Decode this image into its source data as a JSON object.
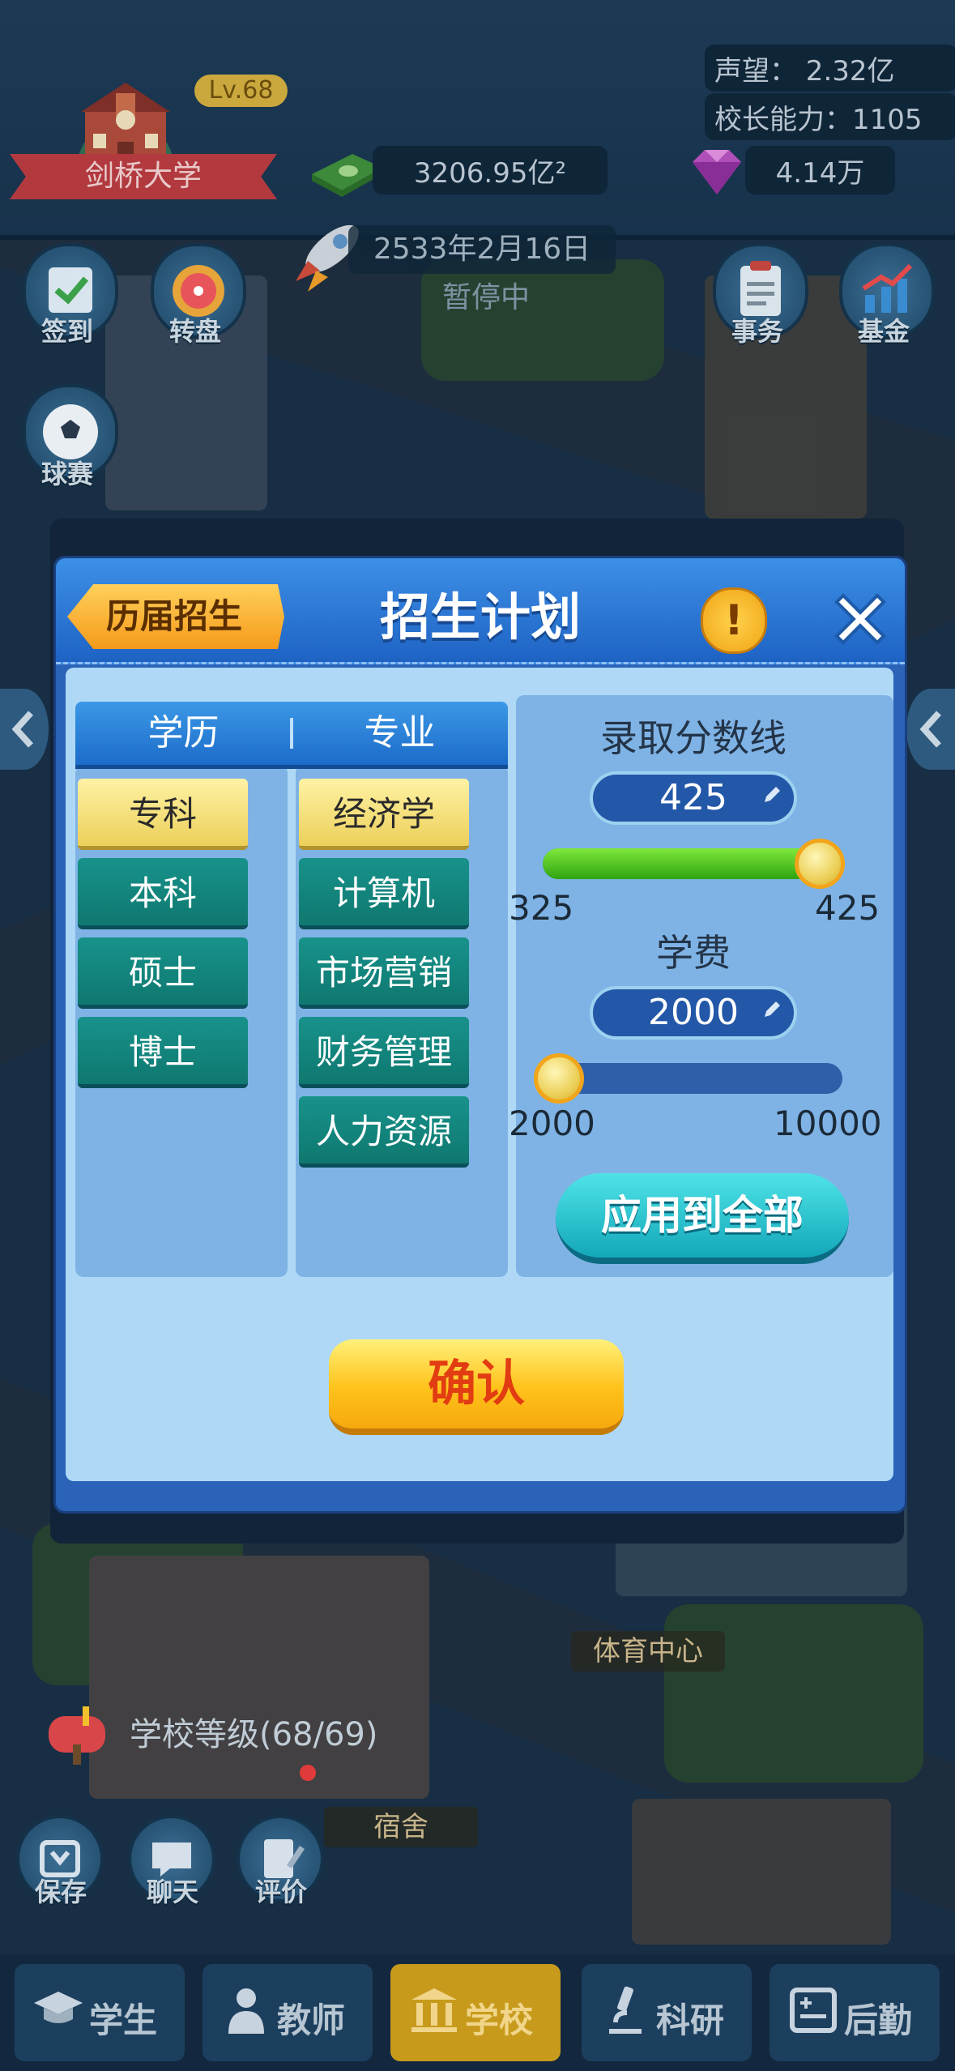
{
  "hud": {
    "school_name": "剑桥大学",
    "level": "Lv.68",
    "money": "3206.95亿²",
    "prestige": "声望：  2.32亿",
    "principal_ability": "校长能力：1105",
    "gems": "4.14万",
    "date": "2533年2月16日",
    "status": "暂停中"
  },
  "side_buttons": {
    "checkin": "签到",
    "wheel": "转盘",
    "match": "球赛",
    "affairs": "事务",
    "fund": "基金"
  },
  "modal": {
    "title": "招生计划",
    "history_button": "历届招生",
    "tabs": [
      "学历",
      "专业"
    ],
    "degrees": [
      {
        "label": "专科",
        "selected": true
      },
      {
        "label": "本科",
        "selected": false
      },
      {
        "label": "硕士",
        "selected": false
      },
      {
        "label": "博士",
        "selected": false
      }
    ],
    "majors": [
      {
        "label": "经济学",
        "selected": true
      },
      {
        "label": "计算机",
        "selected": false
      },
      {
        "label": "市场营销",
        "selected": false
      },
      {
        "label": "财务管理",
        "selected": false
      },
      {
        "label": "人力资源",
        "selected": false
      }
    ],
    "score": {
      "label": "录取分数线",
      "value": "425",
      "min": "325",
      "max": "425",
      "fraction": 1.0
    },
    "fee": {
      "label": "学费",
      "value": "2000",
      "min": "2000",
      "max": "10000",
      "fraction": 0.0
    },
    "apply_all": "应用到全部",
    "confirm": "确认"
  },
  "map_labels": {
    "sports_center": "体育中心",
    "dorm": "宿舍",
    "school_level": "学校等级(68/69)"
  },
  "bottom_left": {
    "save": "保存",
    "chat": "聊天",
    "review": "评价"
  },
  "nav": [
    {
      "label": "学生",
      "icon": "graduation-cap-icon",
      "active": false
    },
    {
      "label": "教师",
      "icon": "teacher-icon",
      "active": false
    },
    {
      "label": "学校",
      "icon": "school-building-icon",
      "active": true
    },
    {
      "label": "科研",
      "icon": "microscope-icon",
      "active": false
    },
    {
      "label": "后勤",
      "icon": "logistics-icon",
      "active": false
    }
  ],
  "colors": {
    "accent_blue": "#2a63b8",
    "confirm_yellow": "#ffc21a",
    "apply_teal": "#13a7b9",
    "selected_item": "#ecd05a",
    "item_teal": "#0f7870"
  }
}
